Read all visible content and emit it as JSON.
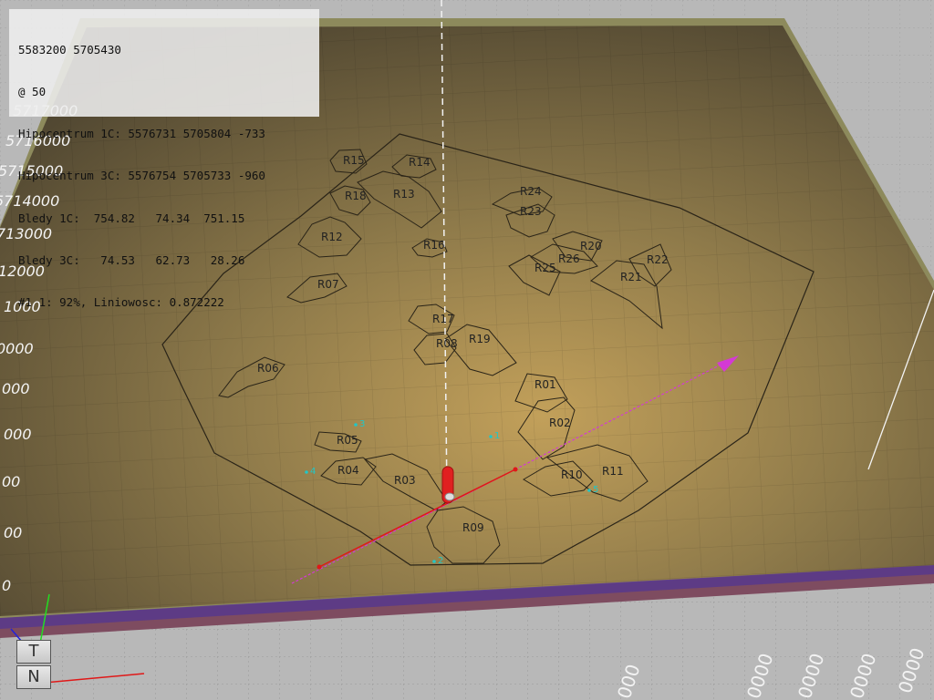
{
  "info_panel": {
    "lines": [
      "5583200 5705430",
      "@ 50",
      "Hipocentrum 1C: 5576731 5705804 -733",
      "Hipocentrum 3C: 5576754 5705733 -960",
      "Bledy 1C:  754.82   74.34  751.15",
      "Bledy 3C:   74.53   62.73   28.26",
      "#1 1: 92%, Liniowosc: 0.872222"
    ]
  },
  "left_axis_labels": [
    "5717000",
    "5716000",
    "5715000",
    "5714000",
    "713000",
    "12000",
    "1000",
    "0000",
    "000",
    "000",
    "00",
    "00",
    "0"
  ],
  "bottom_axis_labels": [
    "000",
    "0000",
    "0000",
    "0000",
    "0000"
  ],
  "regions": [
    {
      "id": "r15",
      "label": "R15"
    },
    {
      "id": "r14",
      "label": "R14"
    },
    {
      "id": "r18",
      "label": "R18"
    },
    {
      "id": "r13",
      "label": "R13"
    },
    {
      "id": "r24",
      "label": "R24"
    },
    {
      "id": "r23",
      "label": "R23"
    },
    {
      "id": "r12",
      "label": "R12"
    },
    {
      "id": "r16",
      "label": "R16"
    },
    {
      "id": "r20",
      "label": "R20"
    },
    {
      "id": "r26",
      "label": "R26"
    },
    {
      "id": "r22",
      "label": "R22"
    },
    {
      "id": "r25",
      "label": "R25"
    },
    {
      "id": "r21",
      "label": "R21"
    },
    {
      "id": "r07",
      "label": "R07"
    },
    {
      "id": "r17",
      "label": "R17"
    },
    {
      "id": "r08",
      "label": "R08"
    },
    {
      "id": "r19",
      "label": "R19"
    },
    {
      "id": "r06",
      "label": "R06"
    },
    {
      "id": "r01",
      "label": "R01"
    },
    {
      "id": "r02",
      "label": "R02"
    },
    {
      "id": "r05",
      "label": "R05"
    },
    {
      "id": "r04",
      "label": "R04"
    },
    {
      "id": "r03",
      "label": "R03"
    },
    {
      "id": "r10",
      "label": "R10"
    },
    {
      "id": "r11",
      "label": "R11"
    },
    {
      "id": "r09",
      "label": "R09"
    }
  ],
  "events": [
    {
      "id": "ev1",
      "label": "1"
    },
    {
      "id": "ev2",
      "label": "2"
    },
    {
      "id": "ev3",
      "label": "3"
    },
    {
      "id": "ev4",
      "label": "4"
    },
    {
      "id": "ev5",
      "label": "5"
    }
  ],
  "view_cube": {
    "top_face": "T",
    "front_face": "N"
  },
  "colors": {
    "ground": "#6b5d3d",
    "ground_glow": "#b39556",
    "plate_border": "#8d8a5c",
    "outline": "#2a2418",
    "event_marker": "#21c7c7",
    "axis_red": "#e01818",
    "axis_magenta": "#d43ad4",
    "hypocenter": "#e02020"
  }
}
